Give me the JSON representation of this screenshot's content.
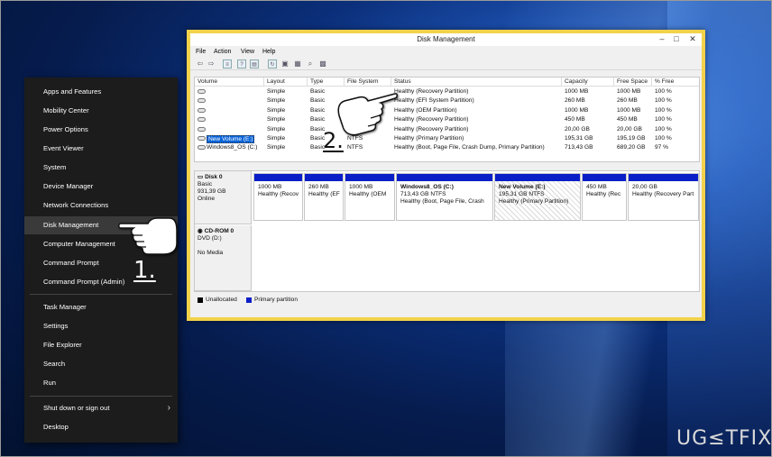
{
  "winx_menu": {
    "items": [
      {
        "label": "Apps and Features"
      },
      {
        "label": "Mobility Center"
      },
      {
        "label": "Power Options"
      },
      {
        "label": "Event Viewer"
      },
      {
        "label": "System"
      },
      {
        "label": "Device Manager"
      },
      {
        "label": "Network Connections"
      },
      {
        "label": "Disk Management"
      },
      {
        "label": "Computer Management"
      },
      {
        "label": "Command Prompt"
      },
      {
        "label": "Command Prompt (Admin)"
      },
      {
        "label": "Task Manager"
      },
      {
        "label": "Settings"
      },
      {
        "label": "File Explorer"
      },
      {
        "label": "Search"
      },
      {
        "label": "Run"
      },
      {
        "label": "Shut down or sign out"
      },
      {
        "label": "Desktop"
      }
    ],
    "highlighted": "Disk Management"
  },
  "window": {
    "title": "Disk Management",
    "controls": {
      "minimize": "–",
      "maximize": "□",
      "close": "✕"
    },
    "menus": [
      "File",
      "Action",
      "View",
      "Help"
    ],
    "toolbar_icons": [
      "back-icon",
      "forward-icon",
      "list-icon",
      "help-icon",
      "properties-icon",
      "refresh-icon",
      "new-icon",
      "open-icon",
      "rescan-icon",
      "settings-icon"
    ]
  },
  "volume_list": {
    "headers": [
      "Volume",
      "Layout",
      "Type",
      "File System",
      "Status",
      "Capacity",
      "Free Space",
      "% Free"
    ],
    "rows": [
      [
        "",
        "Simple",
        "Basic",
        "",
        "Healthy (Recovery Partition)",
        "1000 MB",
        "1000 MB",
        "100 %"
      ],
      [
        "",
        "Simple",
        "Basic",
        "",
        "Healthy (EFI System Partition)",
        "260 MB",
        "260 MB",
        "100 %"
      ],
      [
        "",
        "Simple",
        "Basic",
        "",
        "Healthy (OEM Partition)",
        "1000 MB",
        "1000 MB",
        "100 %"
      ],
      [
        "",
        "Simple",
        "Basic",
        "",
        "Healthy (Recovery Partition)",
        "450 MB",
        "450 MB",
        "100 %"
      ],
      [
        "",
        "Simple",
        "Basic",
        "",
        "Healthy (Recovery Partition)",
        "20,00 GB",
        "20,00 GB",
        "100 %"
      ],
      [
        "New Volume (E:)",
        "Simple",
        "Basic",
        "NTFS",
        "Healthy (Primary Partition)",
        "195,31 GB",
        "195,19 GB",
        "100 %"
      ],
      [
        "Windows8_OS (C:)",
        "Simple",
        "Basic",
        "NTFS",
        "Healthy (Boot, Page File, Crash Dump, Primary Partition)",
        "713,43 GB",
        "689,20 GB",
        "97 %"
      ]
    ]
  },
  "disks": {
    "disk0": {
      "name": "Disk 0",
      "type": "Basic",
      "size": "931,39 GB",
      "state": "Online",
      "partitions": [
        {
          "l1": "",
          "l2": "1000 MB",
          "l3": "Healthy (Recov"
        },
        {
          "l1": "",
          "l2": "260 MB",
          "l3": "Healthy (EF"
        },
        {
          "l1": "",
          "l2": "1000 MB",
          "l3": "Healthy (OEM"
        },
        {
          "l1": "Windows8_OS  (C:)",
          "l2": "713,43 GB NTFS",
          "l3": "Healthy (Boot, Page File, Crash"
        },
        {
          "l1": "New Volume  (E:)",
          "l2": "195,31 GB NTFS",
          "l3": "Healthy (Primary Partition)"
        },
        {
          "l1": "",
          "l2": "450 MB",
          "l3": "Healthy (Rec"
        },
        {
          "l1": "",
          "l2": "20,00 GB",
          "l3": "Healthy (Recovery Part"
        }
      ]
    },
    "cdrom0": {
      "name": "CD-ROM 0",
      "type": "DVD (D:)",
      "state": "No Media"
    }
  },
  "legend": {
    "unallocated": "Unallocated",
    "primary": "Primary partition"
  },
  "annotations": {
    "step1": "1.",
    "step2": "2."
  },
  "watermark": "UG≤TFIX",
  "colors": {
    "primary_partition": "#0a1ec8",
    "selection": "#0a64d8",
    "highlight_border": "#f2d24a"
  }
}
